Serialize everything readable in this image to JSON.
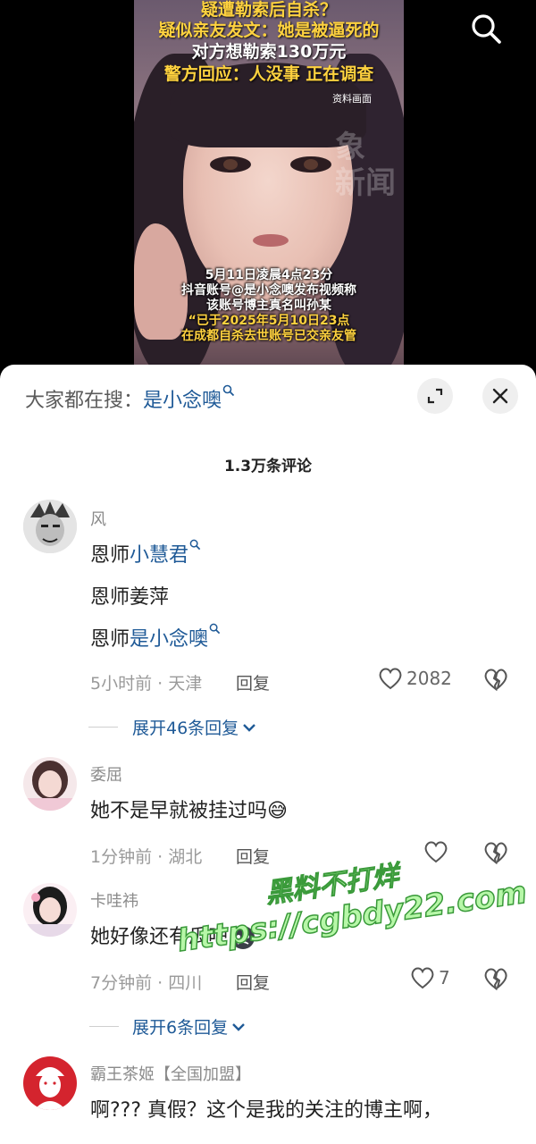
{
  "video": {
    "top_caption": [
      "疑遭勒索后自杀？",
      "疑似亲友发文：她是被逼死的",
      "对方想勒索130万元",
      "警方回应：人没事 正在调查"
    ],
    "source_tag": "资料画面",
    "watermark_glyph": "象\n新闻",
    "bottom_caption": [
      "5月11日凌晨4点23分",
      "抖音账号@是小念噢发布视频称",
      "该账号博主真名叫孙某",
      "“已于2025年5月10日23点",
      "在成都自杀去世账号已交亲友管"
    ]
  },
  "sheet": {
    "search_prefix": "大家都在搜：",
    "search_term": "是小念噢",
    "comment_count": "1.3万条评论"
  },
  "comments": [
    {
      "user": "风",
      "lines": [
        {
          "pre": "恩师",
          "link": "小慧君"
        },
        {
          "pre": "恩师姜萍",
          "link": ""
        },
        {
          "pre": "恩师",
          "link": "是小念噢"
        }
      ],
      "time_loc": "5小时前 · 天津",
      "reply": "回复",
      "likes": "2082",
      "expand": "展开46条回复"
    },
    {
      "user": "委屈",
      "text": "她不是早就被挂过吗",
      "emoji": "😅",
      "time_loc": "1分钟前 · 湖北",
      "reply": "回复",
      "likes": ""
    },
    {
      "user": "卡哇祎",
      "text": "她好像还有瓜吧",
      "time_loc": "7分钟前 · 四川",
      "reply": "回复",
      "likes": "7",
      "expand": "展开6条回复"
    },
    {
      "user": "霸王茶姬【全国加盟】",
      "text": "啊???  真假？这个是我的关注的博主啊，"
    }
  ],
  "watermark": {
    "line1": "黑料不打烊",
    "line2": "https://cgbdy22.com"
  }
}
